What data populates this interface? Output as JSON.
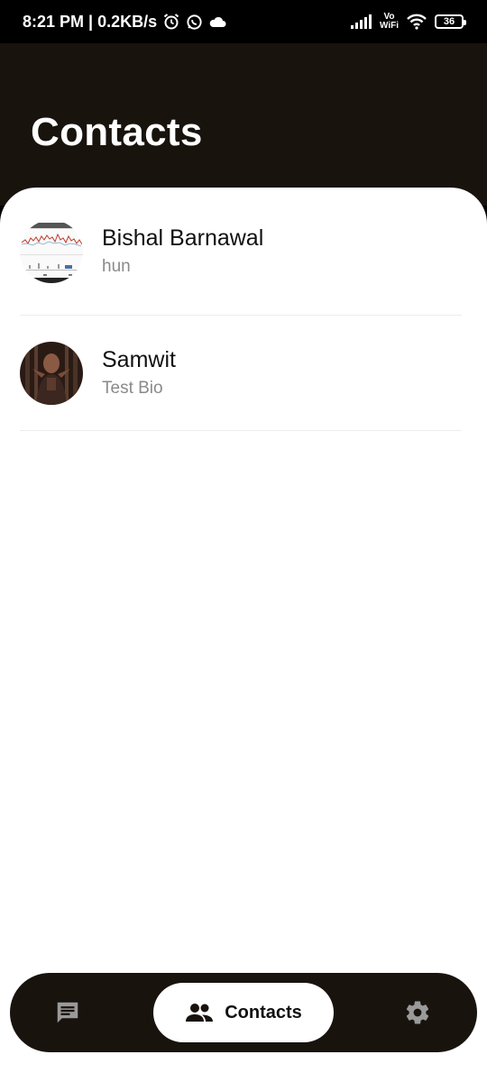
{
  "status_bar": {
    "time": "8:21 PM | 0.2KB/s",
    "vowifi_top": "Vo",
    "vowifi_bottom": "WiFi",
    "battery": "36",
    "icons": [
      "alarm-icon",
      "whatsapp-icon",
      "cloud-icon",
      "signal-icon",
      "wifi-icon",
      "battery-icon"
    ]
  },
  "header": {
    "title": "Contacts"
  },
  "contacts": [
    {
      "name": "Bishal Barnawal",
      "bio": "hun",
      "avatar": "chart-screenshot-avatar"
    },
    {
      "name": "Samwit",
      "bio": "Test Bio",
      "avatar": "person-photo-avatar"
    }
  ],
  "bottom_nav": {
    "items": [
      {
        "icon": "chat-icon",
        "label": ""
      },
      {
        "icon": "people-icon",
        "label": "Contacts",
        "active": true
      },
      {
        "icon": "gear-icon",
        "label": ""
      }
    ]
  },
  "colors": {
    "header_bg": "#18130d",
    "nav_bg": "#18130d",
    "active_pill": "#ffffff"
  }
}
